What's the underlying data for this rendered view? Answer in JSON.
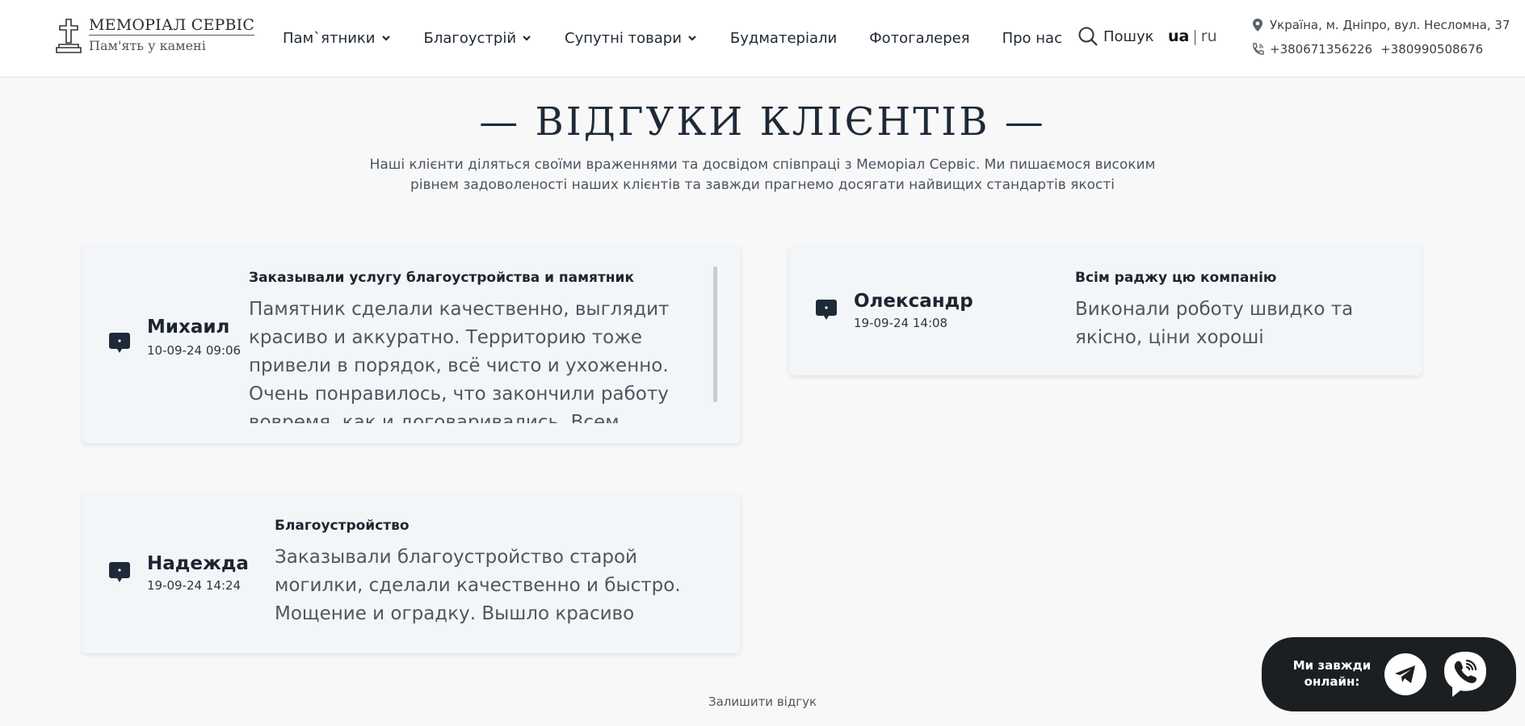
{
  "header": {
    "logo_title": "МЕМОРІАЛ СЕРВІС",
    "logo_subtitle": "Пам'ять у камені",
    "nav": [
      {
        "label": "Пам`ятники",
        "dropdown": true
      },
      {
        "label": "Благоустрій",
        "dropdown": true
      },
      {
        "label": "Супутні товари",
        "dropdown": true
      },
      {
        "label": "Будматеріали",
        "dropdown": false
      },
      {
        "label": "Фотогалерея",
        "dropdown": false
      },
      {
        "label": "Про нас",
        "dropdown": false
      }
    ],
    "search_label": "Пошук",
    "lang_active": "ua",
    "lang_separator": "|",
    "lang_other": "ru",
    "address": "Україна, м. Дніпро, вул. Несломна, 37",
    "phone1": "+380671356226",
    "phone2": "+380990508676"
  },
  "section": {
    "title": "— ВІДГУКИ КЛІЄНТІВ —",
    "description": "Наші клієнти діляться своїми враженнями та досвідом співпраці з Меморіал Сервіс. Ми пишаємося високим рівнем задоволеності наших клієнтів та завжди прагнемо досягати найвищих стандартів якості"
  },
  "reviews": [
    {
      "name": "Михаил",
      "date": "10-09-24 09:06",
      "title": "Заказывали услугу благоустройства и памятник",
      "text": "Памятник сделали качественно, выглядит красиво и аккуратно. Территорию тоже привели в порядок, всё чисто и ухоженно. Очень понравилось, что закончили работу вовремя, как и договаривались. Всем советую! Спасибо"
    },
    {
      "name": "Олександр",
      "date": "19-09-24 14:08",
      "title": "Всім раджу цю компанію",
      "text": "Виконали роботу швидко та якісно, ціни хороші"
    },
    {
      "name": "Надежда",
      "date": "19-09-24 14:24",
      "title": "Благоустройство",
      "text": "Заказывали благоустройство старой могилки, сделали качественно и быстро. Мощение и оградку. Вышло красиво"
    }
  ],
  "leave_review": "Залишити відгук",
  "widget": {
    "text": "Ми завжди онлайн:",
    "telegram_icon": "telegram-icon",
    "viber_icon": "viber-icon"
  },
  "colors": {
    "background": "#f8f8f8",
    "card": "#f3f6f9",
    "text_dark": "#1c2530",
    "widget_bg": "#1c1f22"
  }
}
